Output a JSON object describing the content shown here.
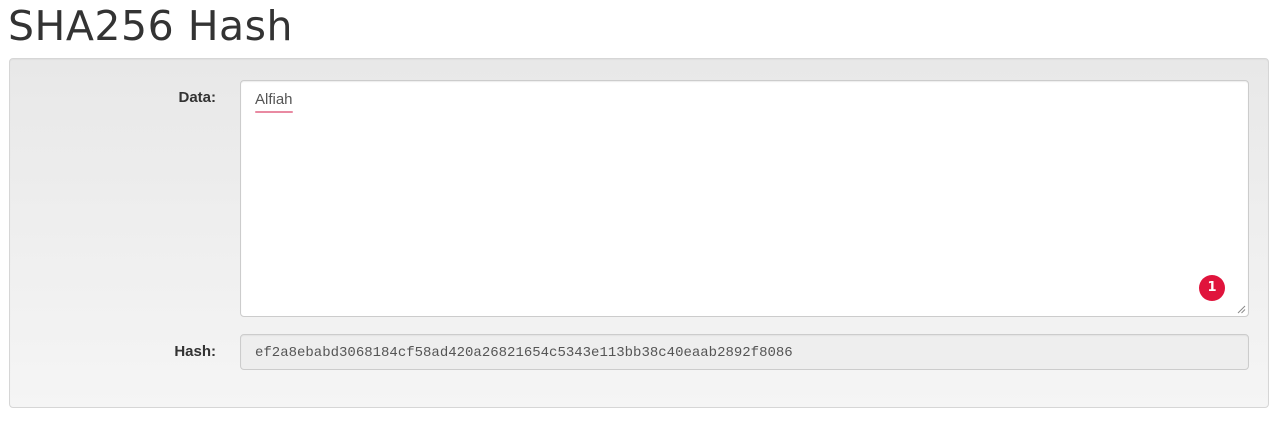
{
  "page": {
    "title": "SHA256 Hash"
  },
  "form": {
    "data_label": "Data:",
    "data_value": "Alfiah",
    "hash_label": "Hash:",
    "hash_value": "ef2a8ebabd3068184cf58ad420a26821654c5343e113bb38c40eaab2892f8086"
  },
  "badge": {
    "count": "1",
    "color": "#e0143c"
  },
  "icons": {
    "resize": "resize-handle-icon",
    "badge": "notification-badge-icon"
  }
}
